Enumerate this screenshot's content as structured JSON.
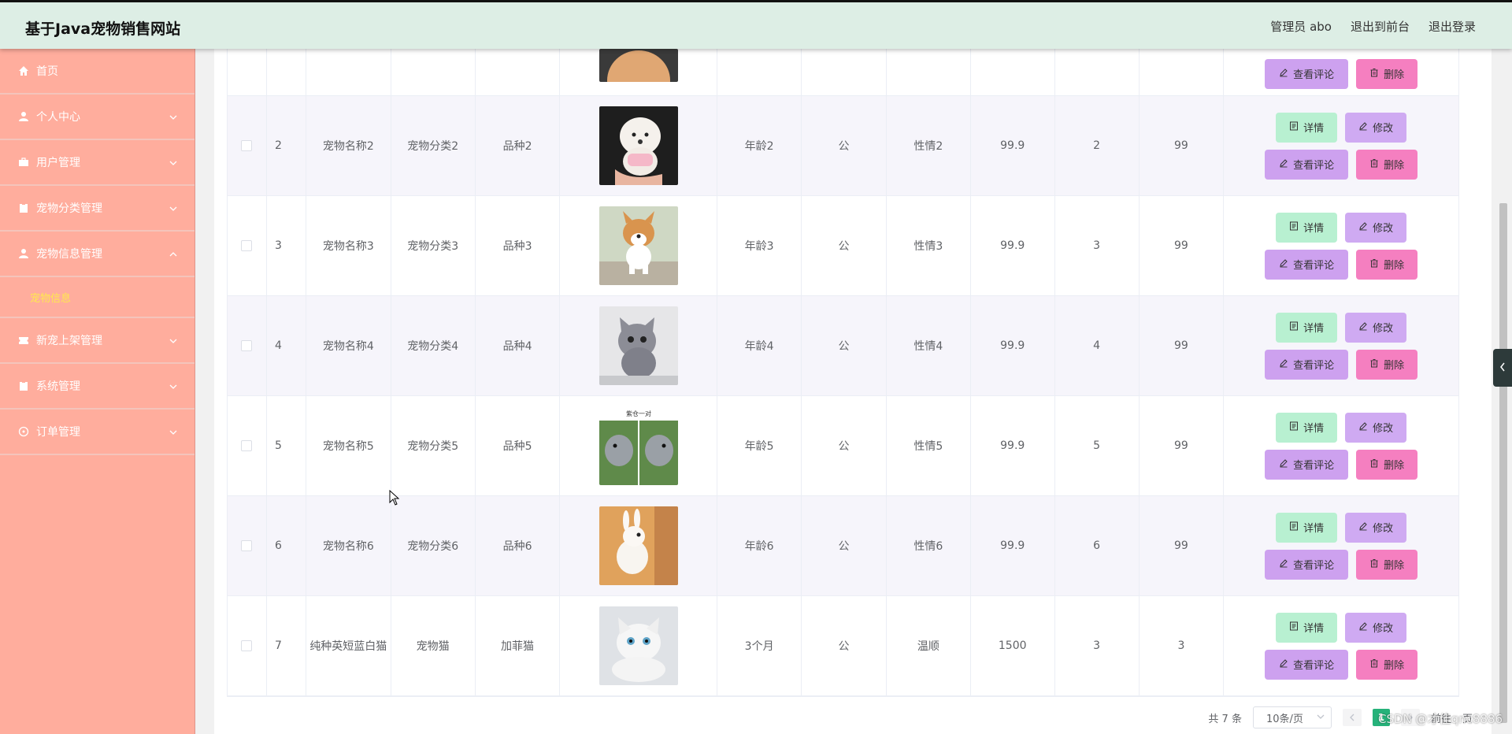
{
  "header": {
    "title": "基于Java宠物销售网站",
    "links": [
      "管理员 abo",
      "退出到前台",
      "退出登录"
    ]
  },
  "sidebar": {
    "items": [
      {
        "label": "首页",
        "icon": "home-icon",
        "has_arrow": false
      },
      {
        "label": "个人中心",
        "icon": "user-icon",
        "has_arrow": true
      },
      {
        "label": "用户管理",
        "icon": "briefcase-icon",
        "has_arrow": true
      },
      {
        "label": "宠物分类管理",
        "icon": "clipboard-icon",
        "has_arrow": true
      },
      {
        "label": "宠物信息管理",
        "icon": "user-icon",
        "has_arrow": true,
        "expanded": true
      },
      {
        "label": "新宠上架管理",
        "icon": "ticket-icon",
        "has_arrow": true
      },
      {
        "label": "系统管理",
        "icon": "clipboard-icon",
        "has_arrow": true
      },
      {
        "label": "订单管理",
        "icon": "compass-icon",
        "has_arrow": true
      }
    ],
    "active_submenu": "宠物信息"
  },
  "table": {
    "rows": [
      {
        "index": "",
        "name": "",
        "category": "",
        "breed": "",
        "age": "",
        "sex": "",
        "temperament": "",
        "price": "",
        "stock": "",
        "num": "",
        "pet": "dog-tan"
      },
      {
        "index": "2",
        "name": "宠物名称2",
        "category": "宠物分类2",
        "breed": "品种2",
        "age": "年龄2",
        "sex": "公",
        "temperament": "性情2",
        "price": "99.9",
        "stock": "2",
        "num": "99",
        "pet": "dog-white"
      },
      {
        "index": "3",
        "name": "宠物名称3",
        "category": "宠物分类3",
        "breed": "品种3",
        "age": "年龄3",
        "sex": "公",
        "temperament": "性情3",
        "price": "99.9",
        "stock": "3",
        "num": "99",
        "pet": "dog-corgi"
      },
      {
        "index": "4",
        "name": "宠物名称4",
        "category": "宠物分类4",
        "breed": "品种4",
        "age": "年龄4",
        "sex": "公",
        "temperament": "性情4",
        "price": "99.9",
        "stock": "4",
        "num": "99",
        "pet": "cat-gray"
      },
      {
        "index": "5",
        "name": "宠物名称5",
        "category": "宠物分类5",
        "breed": "品种5",
        "age": "年龄5",
        "sex": "公",
        "temperament": "性情5",
        "price": "99.9",
        "stock": "5",
        "num": "99",
        "pet": "hamster-pair",
        "img_caption": "紫仓一对"
      },
      {
        "index": "6",
        "name": "宠物名称6",
        "category": "宠物分类6",
        "breed": "品种6",
        "age": "年龄6",
        "sex": "公",
        "temperament": "性情6",
        "price": "99.9",
        "stock": "6",
        "num": "99",
        "pet": "rabbit"
      },
      {
        "index": "7",
        "name": "纯种英短蓝白猫",
        "category": "宠物猫",
        "breed": "加菲猫",
        "age": "3个月",
        "sex": "公",
        "temperament": "温顺",
        "price": "1500",
        "stock": "3",
        "num": "3",
        "pet": "cat-white"
      }
    ],
    "buttons": {
      "detail": "详情",
      "edit": "修改",
      "review": "查看评论",
      "delete": "删除"
    }
  },
  "pagination": {
    "total": "共 7 条",
    "page_size": "10条/页",
    "current_page": "1",
    "goto_label": "前往",
    "page_suffix": "页"
  },
  "watermark": "CSDN @才佳qnc8886",
  "colors": {
    "header_bg": "#ddeee5",
    "sidebar_bg": "#ffad9d",
    "active_submenu": "#ffe94d",
    "btn_detail": "#b8f0d1",
    "btn_edit": "#cfaaf2",
    "btn_review": "#cda1ef",
    "btn_delete": "#f57fc0",
    "page_active": "#26b27a"
  }
}
